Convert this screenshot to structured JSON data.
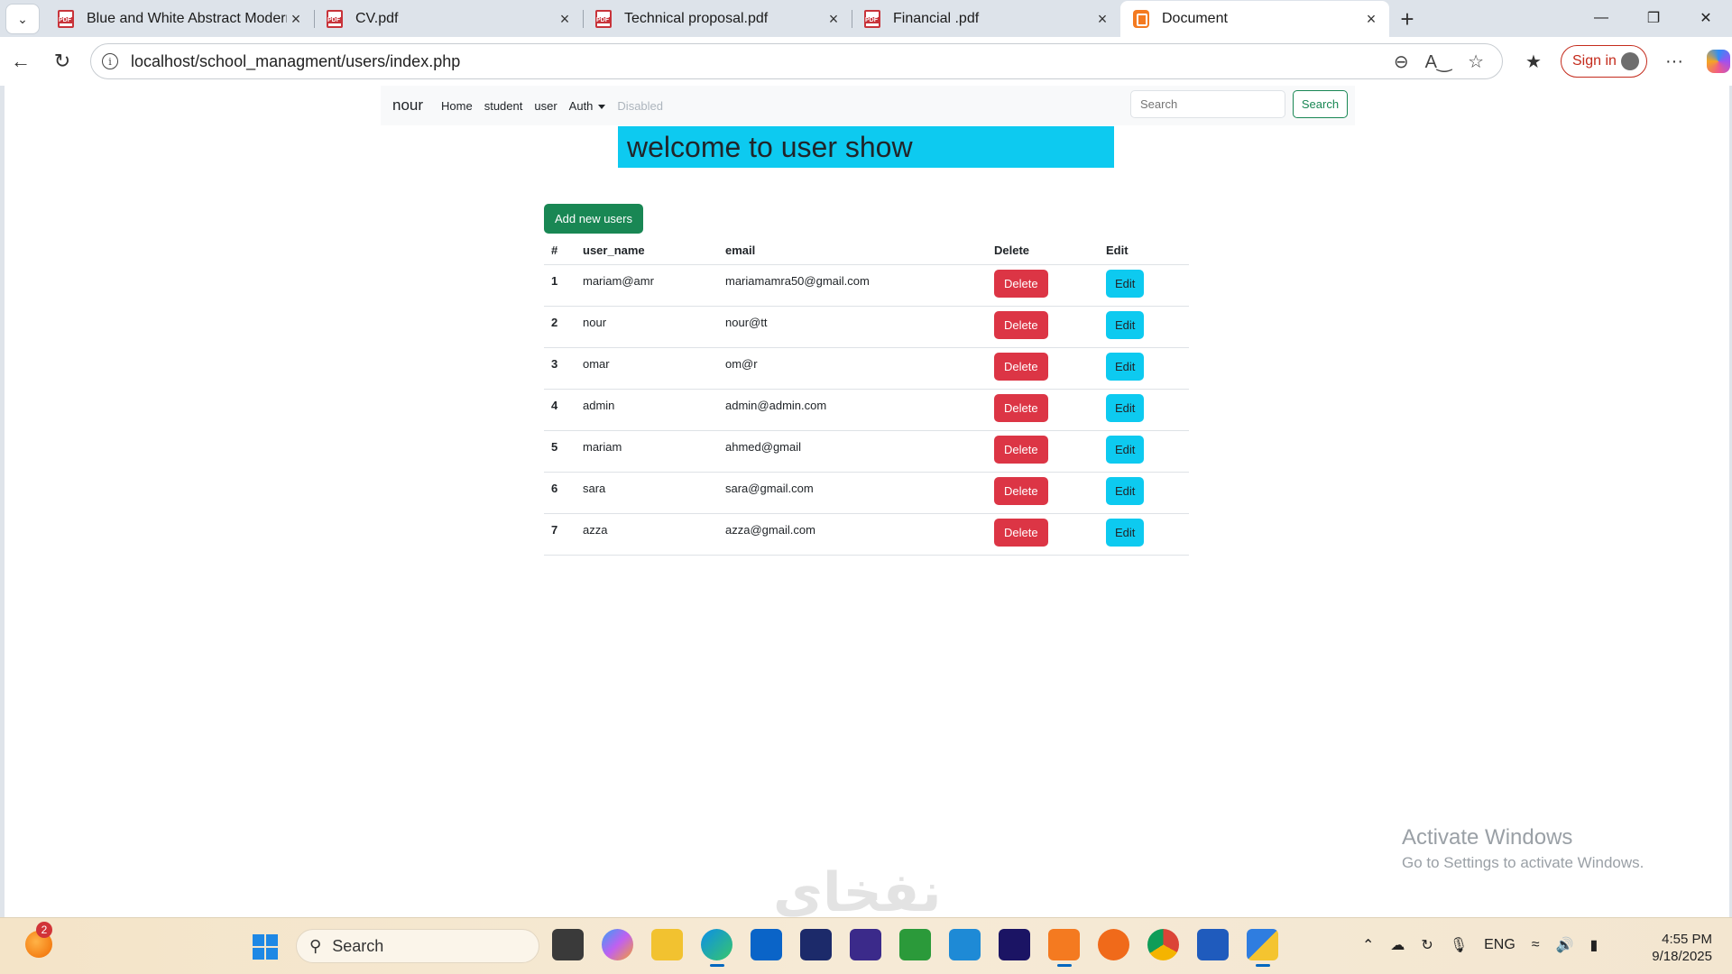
{
  "browser": {
    "tabs": [
      {
        "title": "Blue and White Abstract Modern",
        "icon": "pdf-icon"
      },
      {
        "title": "CV.pdf",
        "icon": "pdf-icon"
      },
      {
        "title": "Technical proposal.pdf",
        "icon": "pdf-icon"
      },
      {
        "title": "Financial .pdf",
        "icon": "pdf-icon"
      },
      {
        "title": "Document",
        "icon": "xampp-icon",
        "active": true
      }
    ],
    "url": "localhost/school_managment/users/index.php",
    "sign_in_label": "Sign in"
  },
  "navbar": {
    "brand": "nour",
    "links": [
      "Home",
      "student",
      "user",
      "Auth",
      "Disabled"
    ],
    "search_placeholder": "Search",
    "search_button": "Search"
  },
  "page": {
    "heading": "welcome to user show",
    "add_button": "Add new users"
  },
  "table": {
    "headers": [
      "#",
      "user_name",
      "email",
      "Delete",
      "Edit"
    ],
    "delete_label": "Delete",
    "edit_label": "Edit",
    "rows": [
      {
        "id": "1",
        "user_name": "mariam@amr",
        "email": "mariamamra50@gmail.com"
      },
      {
        "id": "2",
        "user_name": "nour",
        "email": "nour@tt"
      },
      {
        "id": "3",
        "user_name": "omar",
        "email": "om@r"
      },
      {
        "id": "4",
        "user_name": "admin",
        "email": "admin@admin.com"
      },
      {
        "id": "5",
        "user_name": "mariam",
        "email": "ahmed@gmail"
      },
      {
        "id": "6",
        "user_name": "sara",
        "email": "sara@gmail.com"
      },
      {
        "id": "7",
        "user_name": "azza",
        "email": "azza@gmail.com"
      }
    ]
  },
  "overlay": {
    "activate_title": "Activate Windows",
    "activate_sub": "Go to Settings to activate Windows.",
    "watermark": "نفخاي"
  },
  "taskbar": {
    "weather_badge": "2",
    "search_label": "Search",
    "language": "ENG",
    "time": "4:55 PM",
    "date": "9/18/2025"
  },
  "colors": {
    "primary_green": "#198754",
    "danger_red": "#dc3545",
    "info_cyan": "#0dcaf0"
  }
}
